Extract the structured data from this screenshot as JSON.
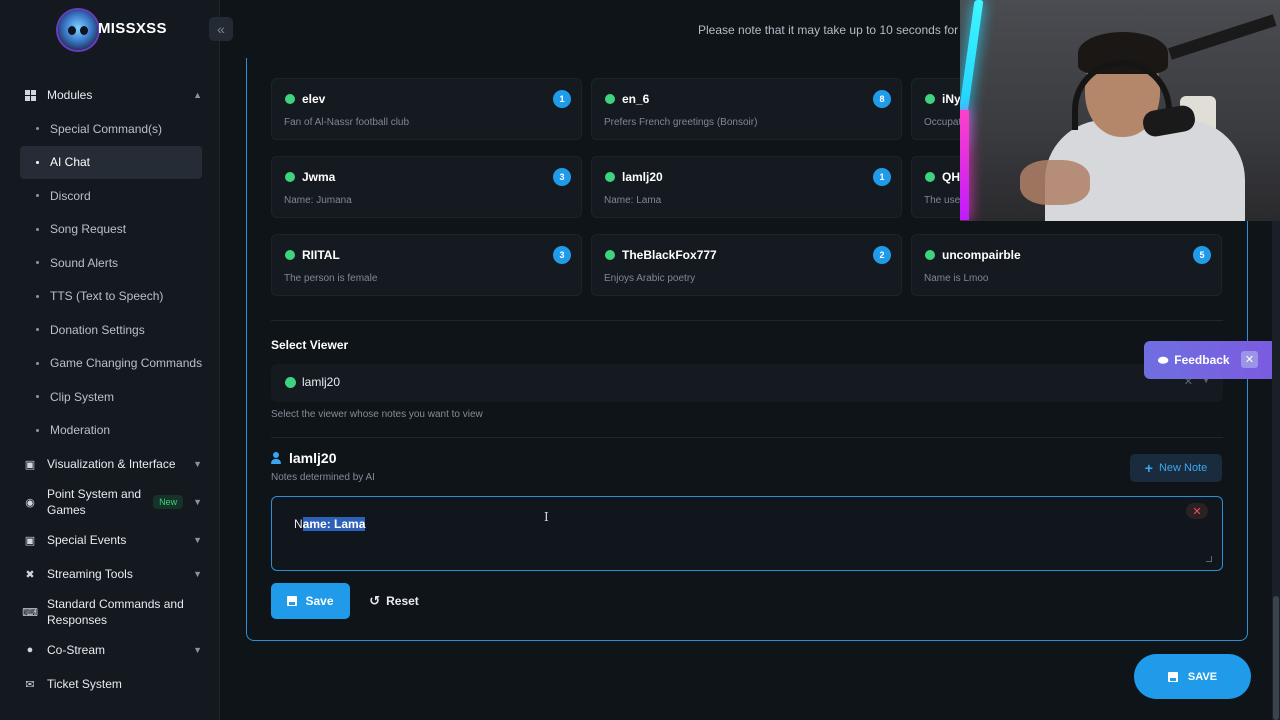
{
  "app": {
    "logo_text": "MISSXSS",
    "collapse_glyph": "«",
    "notice": "Please note that it may take up to 10 seconds for yo"
  },
  "sidebar": {
    "groups": [
      {
        "label": "Modules",
        "icon": "grid-icon",
        "expanded": true,
        "items": [
          "Special Command(s)",
          "AI Chat",
          "Discord",
          "Song Request",
          "Sound Alerts",
          "TTS (Text to Speech)",
          "Donation Settings",
          "Game Changing Commands",
          "Clip System",
          "Moderation"
        ],
        "active_item": "AI Chat"
      },
      {
        "label": "Visualization & Interface",
        "icon": "calendar-icon"
      },
      {
        "label": "Point System and Games",
        "icon": "coins-icon",
        "badge": "New"
      },
      {
        "label": "Special Events",
        "icon": "calendar-icon"
      },
      {
        "label": "Streaming Tools",
        "icon": "tools-icon"
      },
      {
        "label": "Standard Commands and Responses",
        "icon": "keyboard-icon"
      },
      {
        "label": "Co-Stream",
        "icon": "users-icon"
      },
      {
        "label": "Ticket System",
        "icon": "ticket-icon"
      }
    ]
  },
  "viewers": [
    {
      "name": "elev",
      "note": "Fan of Al-Nassr football club",
      "count": "1"
    },
    {
      "name": "en_6",
      "note": "Prefers French greetings (Bonsoir)",
      "count": "8"
    },
    {
      "name": "iNye",
      "note": "Occupat",
      "count": ""
    },
    {
      "name": "Jwma",
      "note": "Name: Jumana",
      "count": "3"
    },
    {
      "name": "lamlj20",
      "note": "Name: Lama",
      "count": "1"
    },
    {
      "name": "QHT",
      "note": "The user",
      "count": ""
    },
    {
      "name": "RIITAL",
      "note": "The person is female",
      "count": "3"
    },
    {
      "name": "TheBlackFox777",
      "note": "Enjoys Arabic poetry",
      "count": "2"
    },
    {
      "name": "uncompairble",
      "note": "Name is Lmoo",
      "count": "5"
    }
  ],
  "select_viewer": {
    "label": "Select Viewer",
    "value": "lamlj20",
    "help": "Select the viewer whose notes you want to view"
  },
  "notes": {
    "username": "lamlj20",
    "subtitle": "Notes determined by AI",
    "new_note_label": "New Note",
    "note_text_prefix": "N",
    "note_text_selected": "ame: Lama",
    "save_label": "Save",
    "reset_label": "Reset"
  },
  "feedback": {
    "label": "Feedback"
  },
  "footer": {
    "save_label": "SAVE"
  },
  "colors": {
    "accent": "#1f9bea",
    "online": "#3ed37f",
    "danger": "#f04e5e"
  }
}
